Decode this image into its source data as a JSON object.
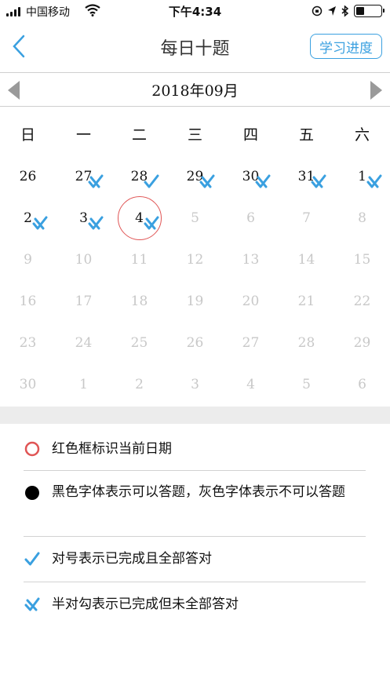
{
  "status_bar": {
    "carrier": "中国移动",
    "time": "下午4:34"
  },
  "nav": {
    "title": "每日十题",
    "progress_button": "学习进度"
  },
  "calendar": {
    "month_label": "2018年09月",
    "weekdays": [
      "日",
      "一",
      "二",
      "三",
      "四",
      "五",
      "六"
    ],
    "weeks": [
      [
        {
          "d": "26",
          "s": "dark",
          "m": ""
        },
        {
          "d": "27",
          "s": "dark",
          "m": "half"
        },
        {
          "d": "28",
          "s": "dark",
          "m": "full"
        },
        {
          "d": "29",
          "s": "dark",
          "m": "half"
        },
        {
          "d": "30",
          "s": "dark",
          "m": "half"
        },
        {
          "d": "31",
          "s": "dark",
          "m": "half"
        },
        {
          "d": "1",
          "s": "dark",
          "m": "half"
        }
      ],
      [
        {
          "d": "2",
          "s": "dark",
          "m": "half"
        },
        {
          "d": "3",
          "s": "dark",
          "m": "half"
        },
        {
          "d": "4",
          "s": "dark",
          "m": "half",
          "today": true
        },
        {
          "d": "5",
          "s": "grey",
          "m": ""
        },
        {
          "d": "6",
          "s": "grey",
          "m": ""
        },
        {
          "d": "7",
          "s": "grey",
          "m": ""
        },
        {
          "d": "8",
          "s": "grey",
          "m": ""
        }
      ],
      [
        {
          "d": "9",
          "s": "grey",
          "m": ""
        },
        {
          "d": "10",
          "s": "grey",
          "m": ""
        },
        {
          "d": "11",
          "s": "grey",
          "m": ""
        },
        {
          "d": "12",
          "s": "grey",
          "m": ""
        },
        {
          "d": "13",
          "s": "grey",
          "m": ""
        },
        {
          "d": "14",
          "s": "grey",
          "m": ""
        },
        {
          "d": "15",
          "s": "grey",
          "m": ""
        }
      ],
      [
        {
          "d": "16",
          "s": "grey",
          "m": ""
        },
        {
          "d": "17",
          "s": "grey",
          "m": ""
        },
        {
          "d": "18",
          "s": "grey",
          "m": ""
        },
        {
          "d": "19",
          "s": "grey",
          "m": ""
        },
        {
          "d": "20",
          "s": "grey",
          "m": ""
        },
        {
          "d": "21",
          "s": "grey",
          "m": ""
        },
        {
          "d": "22",
          "s": "grey",
          "m": ""
        }
      ],
      [
        {
          "d": "23",
          "s": "grey",
          "m": ""
        },
        {
          "d": "24",
          "s": "grey",
          "m": ""
        },
        {
          "d": "25",
          "s": "grey",
          "m": ""
        },
        {
          "d": "26",
          "s": "grey",
          "m": ""
        },
        {
          "d": "27",
          "s": "grey",
          "m": ""
        },
        {
          "d": "28",
          "s": "grey",
          "m": ""
        },
        {
          "d": "29",
          "s": "grey",
          "m": ""
        }
      ],
      [
        {
          "d": "30",
          "s": "grey",
          "m": ""
        },
        {
          "d": "1",
          "s": "grey",
          "m": ""
        },
        {
          "d": "2",
          "s": "grey",
          "m": ""
        },
        {
          "d": "3",
          "s": "grey",
          "m": ""
        },
        {
          "d": "4",
          "s": "grey",
          "m": ""
        },
        {
          "d": "5",
          "s": "grey",
          "m": ""
        },
        {
          "d": "6",
          "s": "grey",
          "m": ""
        }
      ]
    ]
  },
  "legend": [
    {
      "icon": "red-circle-icon",
      "text": "红色框标识当前日期"
    },
    {
      "icon": "black-dot-icon",
      "text": "黑色字体表示可以答题，灰色字体表示不可以答题"
    },
    {
      "icon": "checkmark-icon",
      "text": "对号表示已完成且全部答对"
    },
    {
      "icon": "half-checkmark-icon",
      "text": "半对勾表示已完成但未全部答对"
    }
  ],
  "colors": {
    "accent": "#3aa0e0",
    "today_ring": "#e05555",
    "disabled_text": "#c8c8c8"
  }
}
